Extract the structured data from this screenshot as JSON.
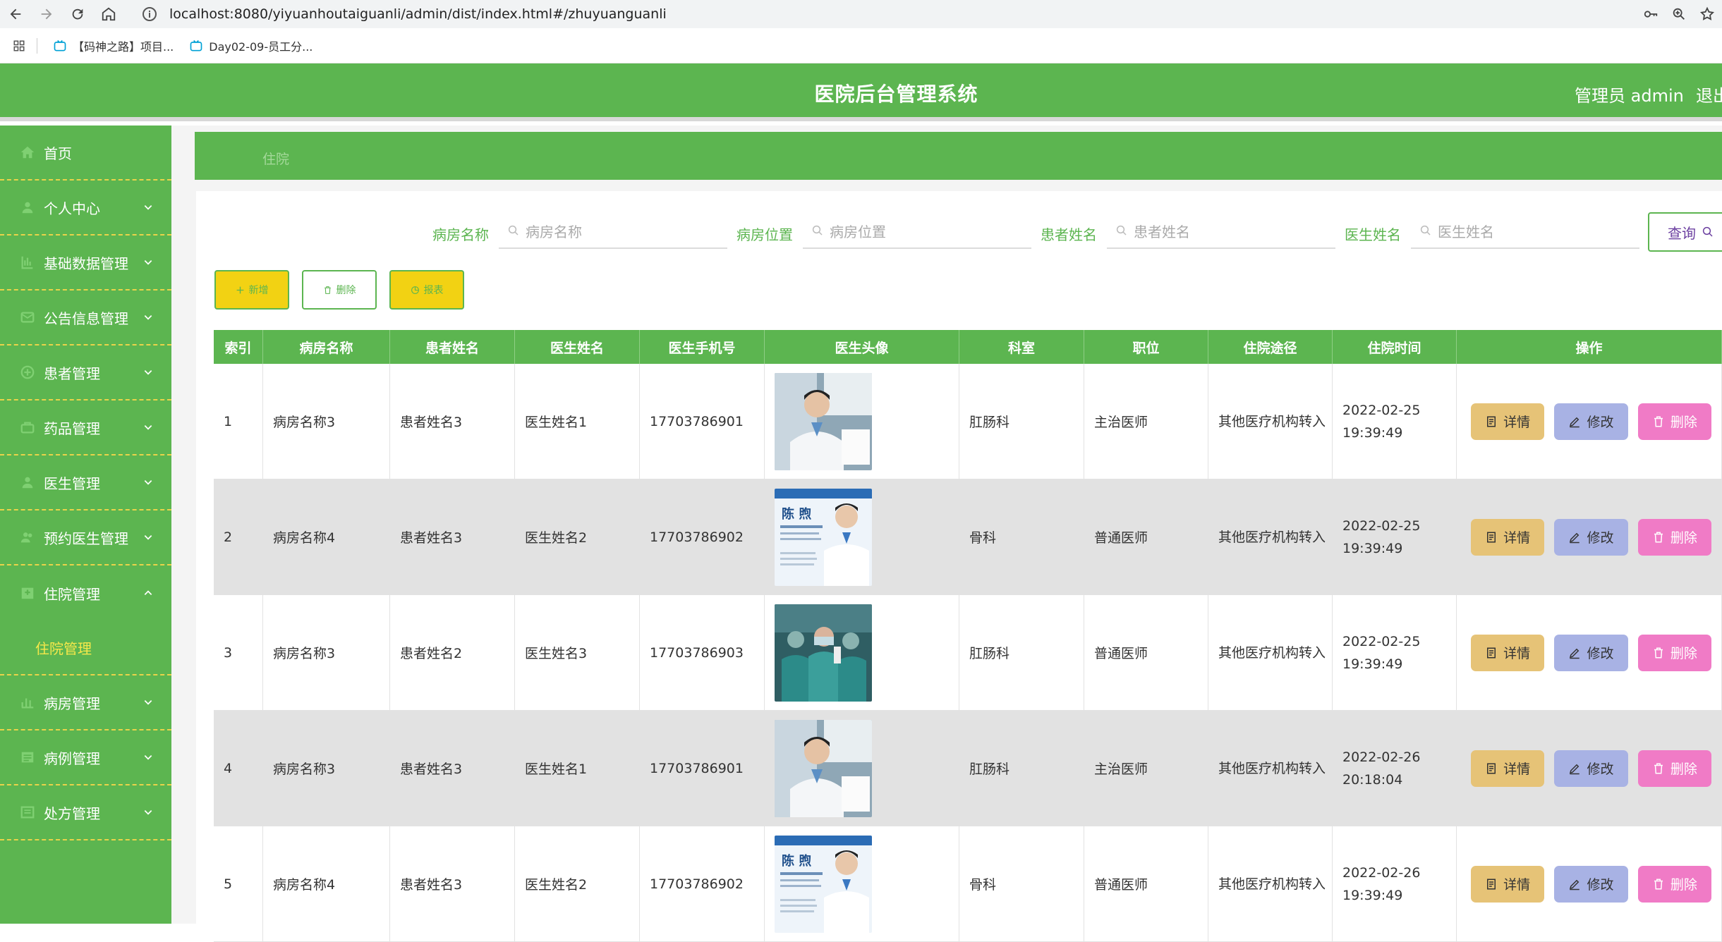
{
  "browser": {
    "url": "localhost:8080/yiyuanhoutaiguanli/admin/dist/index.html#/zhuyuanguanli",
    "bookmarks": [
      "【码神之路】项目...",
      "Day02-09-员工分..."
    ]
  },
  "header": {
    "title": "医院后台管理系统",
    "admin_label": "管理员 admin",
    "logout_label": "退出"
  },
  "sidebar": {
    "items": [
      {
        "label": "首页",
        "icon": "home-icon",
        "has_chevron": false
      },
      {
        "label": "个人中心",
        "icon": "person-icon",
        "has_chevron": true
      },
      {
        "label": "基础数据管理",
        "icon": "data-icon",
        "has_chevron": true
      },
      {
        "label": "公告信息管理",
        "icon": "notice-icon",
        "has_chevron": true
      },
      {
        "label": "患者管理",
        "icon": "patient-icon",
        "has_chevron": true
      },
      {
        "label": "药品管理",
        "icon": "medicine-icon",
        "has_chevron": true
      },
      {
        "label": "医生管理",
        "icon": "doctor-icon",
        "has_chevron": true
      },
      {
        "label": "预约医生管理",
        "icon": "appointment-icon",
        "has_chevron": true
      },
      {
        "label": "住院管理",
        "icon": "hospital-icon",
        "has_chevron": true,
        "expanded": true
      },
      {
        "label": "病房管理",
        "icon": "ward-icon",
        "has_chevron": true
      },
      {
        "label": "病例管理",
        "icon": "case-icon",
        "has_chevron": true
      },
      {
        "label": "处方管理",
        "icon": "prescription-icon",
        "has_chevron": true
      }
    ],
    "sub_item": "住院管理"
  },
  "breadcrumb": "住院",
  "search": {
    "fields": [
      {
        "label": "病房名称",
        "placeholder": "病房名称"
      },
      {
        "label": "病房位置",
        "placeholder": "病房位置"
      },
      {
        "label": "患者姓名",
        "placeholder": "患者姓名"
      },
      {
        "label": "医生姓名",
        "placeholder": "医生姓名"
      }
    ],
    "query_label": "查询"
  },
  "actions": {
    "add": "新增",
    "delete": "删除",
    "report": "报表"
  },
  "table": {
    "headers": [
      "索引",
      "病房名称",
      "患者姓名",
      "医生姓名",
      "医生手机号",
      "医生头像",
      "科室",
      "职位",
      "住院途径",
      "住院时间",
      "操作"
    ],
    "op_labels": {
      "detail": "详情",
      "edit": "修改",
      "remove": "删除"
    },
    "rows": [
      {
        "index": "1",
        "ward": "病房名称3",
        "patient": "患者姓名3",
        "doctor": "医生姓名1",
        "phone": "17703786901",
        "avatar": "doctor-photo-1",
        "dept": "肛肠科",
        "position": "主治医师",
        "route": "其他医疗机构转入",
        "time": "2022-02-25 19:39:49"
      },
      {
        "index": "2",
        "ward": "病房名称4",
        "patient": "患者姓名3",
        "doctor": "医生姓名2",
        "phone": "17703786902",
        "avatar": "doctor-photo-2",
        "dept": "骨科",
        "position": "普通医师",
        "route": "其他医疗机构转入",
        "time": "2022-02-25 19:39:49"
      },
      {
        "index": "3",
        "ward": "病房名称3",
        "patient": "患者姓名2",
        "doctor": "医生姓名3",
        "phone": "17703786903",
        "avatar": "doctor-photo-3",
        "dept": "肛肠科",
        "position": "普通医师",
        "route": "其他医疗机构转入",
        "time": "2022-02-25 19:39:49"
      },
      {
        "index": "4",
        "ward": "病房名称3",
        "patient": "患者姓名3",
        "doctor": "医生姓名1",
        "phone": "17703786901",
        "avatar": "doctor-photo-1",
        "dept": "肛肠科",
        "position": "主治医师",
        "route": "其他医疗机构转入",
        "time": "2022-02-26 20:18:04"
      },
      {
        "index": "5",
        "ward": "病房名称4",
        "patient": "患者姓名3",
        "doctor": "医生姓名2",
        "phone": "17703786902",
        "avatar": "doctor-photo-2",
        "dept": "骨科",
        "position": "普通医师",
        "route": "其他医疗机构转入",
        "time": "2022-02-26 19:39:49"
      }
    ]
  },
  "colors": {
    "primary": "#5cb550",
    "accent_yellow": "#f2d213",
    "detail": "#e6c377",
    "edit": "#a8b2e4",
    "remove": "#f07bc6"
  }
}
